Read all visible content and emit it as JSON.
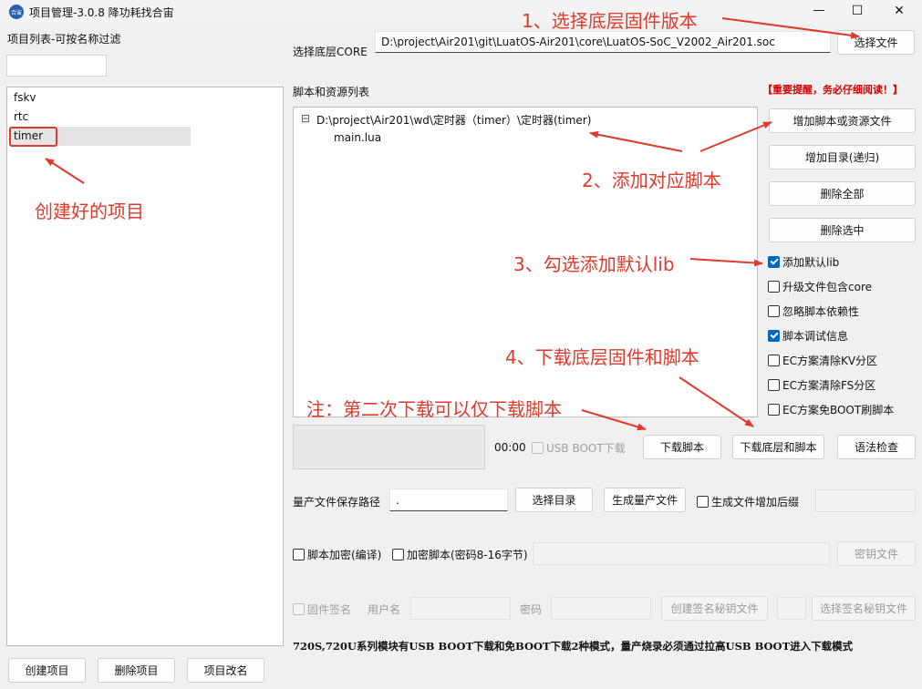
{
  "window": {
    "logo_text": "合宙",
    "title": "项目管理-3.0.8 降功耗找合宙",
    "minimize": "—",
    "maximize": "☐",
    "close": "✕"
  },
  "sidebar": {
    "filter_label": "项目列表-可按名称过滤",
    "filter_value": "",
    "projects": [
      "fskv",
      "rtc",
      "timer"
    ],
    "create_button": "创建项目",
    "delete_button": "删除项目",
    "rename_button": "项目改名"
  },
  "core": {
    "label": "选择底层CORE",
    "path": "D:\\project\\Air201\\git\\LuatOS-Air201\\core\\LuatOS-SoC_V2002_Air201.soc",
    "select_button": "选择文件"
  },
  "scripts": {
    "label": "脚本和资源列表",
    "reminder": "【重要提醒，务必仔细阅读！】",
    "tree_toggle": "⊟",
    "tree_root": "D:\\project\\Air201\\wd\\定时器（timer）\\定时器(timer)",
    "tree_files": [
      "main.lua"
    ],
    "add_file_button": "增加脚本或资源文件",
    "add_dir_button": "增加目录(递归)",
    "delete_all_button": "删除全部",
    "delete_selected_button": "删除选中"
  },
  "options": {
    "add_default_lib": {
      "label": "添加默认lib",
      "checked": true
    },
    "upgrade_include_core": {
      "label": "升级文件包含core",
      "checked": false
    },
    "ignore_dependency": {
      "label": "忽略脚本依赖性",
      "checked": false
    },
    "script_debug_info": {
      "label": "脚本调试信息",
      "checked": true
    },
    "ec_clear_kv": {
      "label": "EC方案清除KV分区",
      "checked": false
    },
    "ec_clear_fs": {
      "label": "EC方案清除FS分区",
      "checked": false
    },
    "ec_no_boot": {
      "label": "EC方案免BOOT刷脚本",
      "checked": false
    }
  },
  "download": {
    "timer": "00:00",
    "usb_boot_label": "USB BOOT下载",
    "download_script_button": "下载脚本",
    "download_all_button": "下载底层和脚本",
    "syntax_check_button": "语法检查"
  },
  "production": {
    "path_label": "量产文件保存路径",
    "path_value": ".",
    "select_dir_button": "选择目录",
    "generate_button": "生成量产文件",
    "suffix_label": "生成文件增加后缀",
    "encrypt_compile_label": "脚本加密(编译)",
    "encrypt_script_label": "加密脚本(密码8-16字节)",
    "key_file_button": "密钥文件",
    "firmware_sign_label": "固件签名",
    "username_label": "用户名",
    "password_label": "密码",
    "create_sign_key_button": "创建签名秘钥文件",
    "select_sign_key_button": "选择签名秘钥文件"
  },
  "footer_note": "720S,720U系列模块有USB BOOT下载和免BOOT下载2种模式，量产烧录必须通过拉高USB BOOT进入下载模式",
  "annotations": {
    "step1": "1、选择底层固件版本",
    "step2": "2、添加对应脚本",
    "step3": "3、勾选添加默认lib",
    "step4": "4、下载底层固件和脚本",
    "note": "注：第二次下载可以仅下载脚本",
    "created": "创建好的项目"
  },
  "colors": {
    "annotation_red": "#e03a2c",
    "accent_blue": "#0067c0",
    "reminder_red": "#d40000"
  }
}
